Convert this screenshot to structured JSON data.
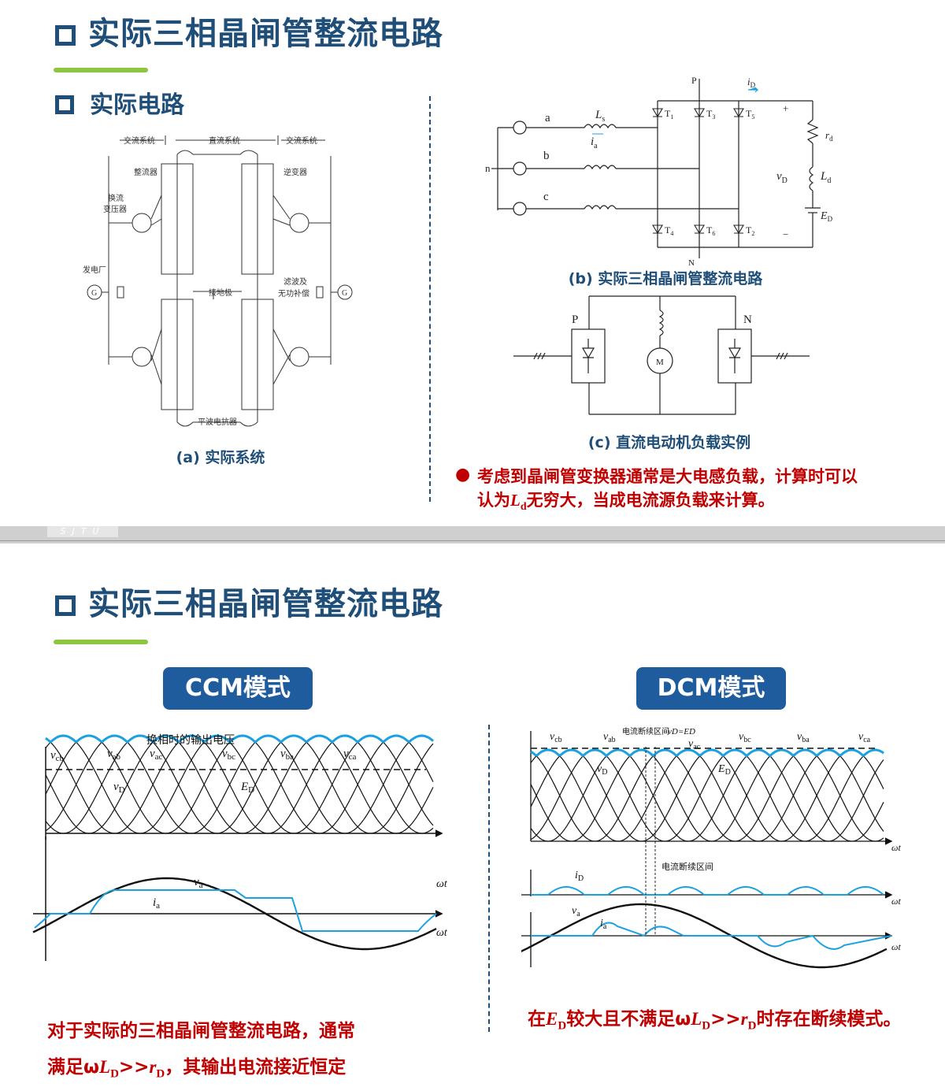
{
  "slide1": {
    "title": "实际三相晶闸管整流电路",
    "subtitle": "实际电路",
    "system": {
      "ac_left": "交流系统",
      "dc": "直流系统",
      "ac_right": "交流系统",
      "rectifier": "整流器",
      "inverter": "逆变器",
      "converter_transformer_1": "换流",
      "converter_transformer_2": "变压器",
      "plant": "发电厂",
      "ground": "接地极",
      "filter_1": "滤波及",
      "filter_2": "无功补偿",
      "reactor": "平波电抗器",
      "gen": "G"
    },
    "circuit": {
      "labels": [
        "a",
        "b",
        "c",
        "n",
        "P",
        "N",
        "+",
        "−"
      ],
      "Ls": "L",
      "Ls_sub": "s",
      "ia": "i",
      "ia_sub": "a",
      "iD": "i",
      "iD_sub": "D",
      "thyristors": [
        [
          "T",
          "1"
        ],
        [
          "T",
          "3"
        ],
        [
          "T",
          "5"
        ],
        [
          "T",
          "4"
        ],
        [
          "T",
          "6"
        ],
        [
          "T",
          "2"
        ]
      ],
      "rd": "r",
      "rd_sub": "d",
      "vD": "v",
      "vD_sub": "D",
      "Ld": "L",
      "Ld_sub": "d",
      "ED": "E",
      "ED_sub": "D"
    },
    "motor": {
      "P": "P",
      "N": "N",
      "M": "M"
    },
    "captions": {
      "a": "(a) 实际系统",
      "b": "(b) 实际三相晶闸管整流电路",
      "c": "(c) 直流电动机负载实例"
    },
    "note_line1": "考虑到晶闸管变换器通常是大电感负载，计算时可以",
    "note_line2_a": "认为",
    "note_line2_L": "L",
    "note_line2_sub": "d",
    "note_line2_b": "无穷大，当成电流源负载来计算。"
  },
  "separator": {
    "logo": "SJTU"
  },
  "slide2": {
    "title": "实际三相晶闸管整流电路",
    "ccm_label": "CCM模式",
    "dcm_label": "DCM模式",
    "ccm_plot": {
      "commutation_label": "换相时的输出电压",
      "phases": [
        [
          "v",
          "cb"
        ],
        [
          "v",
          "ab"
        ],
        [
          "v",
          "ac"
        ],
        [
          "v",
          "bc"
        ],
        [
          "v",
          "ba"
        ],
        [
          "v",
          "ca"
        ]
      ],
      "vD": [
        "v",
        "D"
      ],
      "ED": [
        "E",
        "D"
      ],
      "va": [
        "v",
        "a"
      ],
      "ia": [
        "i",
        "a"
      ],
      "axis": "ωt"
    },
    "dcm_plot": {
      "phases": [
        [
          "v",
          "cb"
        ],
        [
          "v",
          "ab"
        ],
        [
          "v",
          "ac"
        ],
        [
          "v",
          "bc"
        ],
        [
          "v",
          "ba"
        ],
        [
          "v",
          "ca"
        ]
      ],
      "interval_label": "电流断续区间",
      "vD_eq": "vD=ED",
      "vD": [
        "v",
        "D"
      ],
      "ED": [
        "E",
        "D"
      ],
      "iD": [
        "i",
        "D"
      ],
      "va": [
        "v",
        "a"
      ],
      "ia": [
        "i",
        "a"
      ],
      "interval_label2": "电流断续区间",
      "axis": "ωt"
    },
    "ccm_note_1": "对于实际的三相晶闸管整流电路，通常",
    "ccm_note_2a": "满足ω",
    "ccm_note_2L": "L",
    "ccm_note_2Lsub": "D",
    "ccm_note_2b": ">>",
    "ccm_note_2r": "r",
    "ccm_note_2rsub": "D",
    "ccm_note_2c": "，其输出电流接近恒定",
    "dcm_note_a": "在",
    "dcm_note_E": "E",
    "dcm_note_Esub": "D",
    "dcm_note_b": "较大且不满足ω",
    "dcm_note_L": "L",
    "dcm_note_Lsub": "D",
    "dcm_note_c": ">>",
    "dcm_note_r": "r",
    "dcm_note_rsub": "D",
    "dcm_note_d": "时存在断续模式。"
  },
  "colors": {
    "title": "#1f4e79",
    "accent": "#8cc63f",
    "red": "#c00000",
    "badge": "#1f5c9e",
    "wave": "#1ba1e2"
  }
}
